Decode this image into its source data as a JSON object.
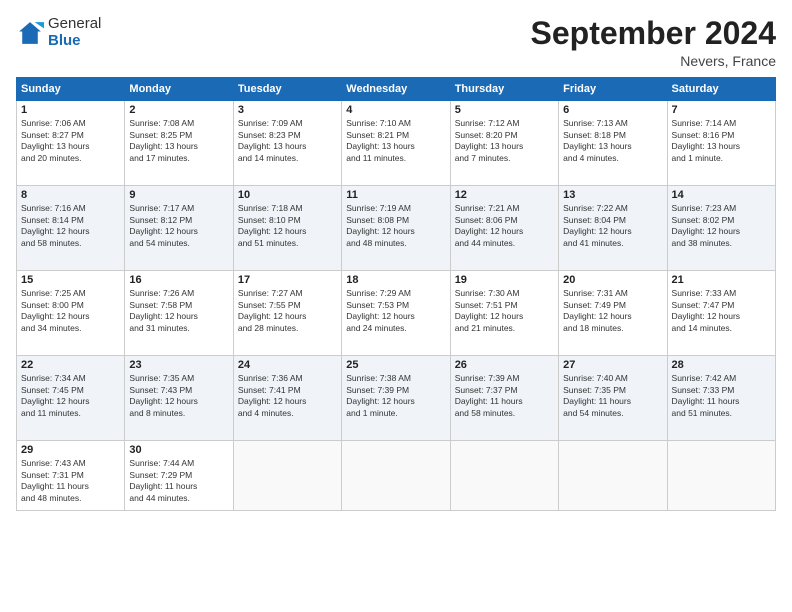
{
  "header": {
    "logo": {
      "general": "General",
      "blue": "Blue"
    },
    "title": "September 2024",
    "location": "Nevers, France"
  },
  "days_of_week": [
    "Sunday",
    "Monday",
    "Tuesday",
    "Wednesday",
    "Thursday",
    "Friday",
    "Saturday"
  ],
  "weeks": [
    [
      {
        "day": "1",
        "info": "Sunrise: 7:06 AM\nSunset: 8:27 PM\nDaylight: 13 hours\nand 20 minutes."
      },
      {
        "day": "2",
        "info": "Sunrise: 7:08 AM\nSunset: 8:25 PM\nDaylight: 13 hours\nand 17 minutes."
      },
      {
        "day": "3",
        "info": "Sunrise: 7:09 AM\nSunset: 8:23 PM\nDaylight: 13 hours\nand 14 minutes."
      },
      {
        "day": "4",
        "info": "Sunrise: 7:10 AM\nSunset: 8:21 PM\nDaylight: 13 hours\nand 11 minutes."
      },
      {
        "day": "5",
        "info": "Sunrise: 7:12 AM\nSunset: 8:20 PM\nDaylight: 13 hours\nand 7 minutes."
      },
      {
        "day": "6",
        "info": "Sunrise: 7:13 AM\nSunset: 8:18 PM\nDaylight: 13 hours\nand 4 minutes."
      },
      {
        "day": "7",
        "info": "Sunrise: 7:14 AM\nSunset: 8:16 PM\nDaylight: 13 hours\nand 1 minute."
      }
    ],
    [
      {
        "day": "8",
        "info": "Sunrise: 7:16 AM\nSunset: 8:14 PM\nDaylight: 12 hours\nand 58 minutes."
      },
      {
        "day": "9",
        "info": "Sunrise: 7:17 AM\nSunset: 8:12 PM\nDaylight: 12 hours\nand 54 minutes."
      },
      {
        "day": "10",
        "info": "Sunrise: 7:18 AM\nSunset: 8:10 PM\nDaylight: 12 hours\nand 51 minutes."
      },
      {
        "day": "11",
        "info": "Sunrise: 7:19 AM\nSunset: 8:08 PM\nDaylight: 12 hours\nand 48 minutes."
      },
      {
        "day": "12",
        "info": "Sunrise: 7:21 AM\nSunset: 8:06 PM\nDaylight: 12 hours\nand 44 minutes."
      },
      {
        "day": "13",
        "info": "Sunrise: 7:22 AM\nSunset: 8:04 PM\nDaylight: 12 hours\nand 41 minutes."
      },
      {
        "day": "14",
        "info": "Sunrise: 7:23 AM\nSunset: 8:02 PM\nDaylight: 12 hours\nand 38 minutes."
      }
    ],
    [
      {
        "day": "15",
        "info": "Sunrise: 7:25 AM\nSunset: 8:00 PM\nDaylight: 12 hours\nand 34 minutes."
      },
      {
        "day": "16",
        "info": "Sunrise: 7:26 AM\nSunset: 7:58 PM\nDaylight: 12 hours\nand 31 minutes."
      },
      {
        "day": "17",
        "info": "Sunrise: 7:27 AM\nSunset: 7:55 PM\nDaylight: 12 hours\nand 28 minutes."
      },
      {
        "day": "18",
        "info": "Sunrise: 7:29 AM\nSunset: 7:53 PM\nDaylight: 12 hours\nand 24 minutes."
      },
      {
        "day": "19",
        "info": "Sunrise: 7:30 AM\nSunset: 7:51 PM\nDaylight: 12 hours\nand 21 minutes."
      },
      {
        "day": "20",
        "info": "Sunrise: 7:31 AM\nSunset: 7:49 PM\nDaylight: 12 hours\nand 18 minutes."
      },
      {
        "day": "21",
        "info": "Sunrise: 7:33 AM\nSunset: 7:47 PM\nDaylight: 12 hours\nand 14 minutes."
      }
    ],
    [
      {
        "day": "22",
        "info": "Sunrise: 7:34 AM\nSunset: 7:45 PM\nDaylight: 12 hours\nand 11 minutes."
      },
      {
        "day": "23",
        "info": "Sunrise: 7:35 AM\nSunset: 7:43 PM\nDaylight: 12 hours\nand 8 minutes."
      },
      {
        "day": "24",
        "info": "Sunrise: 7:36 AM\nSunset: 7:41 PM\nDaylight: 12 hours\nand 4 minutes."
      },
      {
        "day": "25",
        "info": "Sunrise: 7:38 AM\nSunset: 7:39 PM\nDaylight: 12 hours\nand 1 minute."
      },
      {
        "day": "26",
        "info": "Sunrise: 7:39 AM\nSunset: 7:37 PM\nDaylight: 11 hours\nand 58 minutes."
      },
      {
        "day": "27",
        "info": "Sunrise: 7:40 AM\nSunset: 7:35 PM\nDaylight: 11 hours\nand 54 minutes."
      },
      {
        "day": "28",
        "info": "Sunrise: 7:42 AM\nSunset: 7:33 PM\nDaylight: 11 hours\nand 51 minutes."
      }
    ],
    [
      {
        "day": "29",
        "info": "Sunrise: 7:43 AM\nSunset: 7:31 PM\nDaylight: 11 hours\nand 48 minutes."
      },
      {
        "day": "30",
        "info": "Sunrise: 7:44 AM\nSunset: 7:29 PM\nDaylight: 11 hours\nand 44 minutes."
      },
      {
        "day": "",
        "info": ""
      },
      {
        "day": "",
        "info": ""
      },
      {
        "day": "",
        "info": ""
      },
      {
        "day": "",
        "info": ""
      },
      {
        "day": "",
        "info": ""
      }
    ]
  ]
}
